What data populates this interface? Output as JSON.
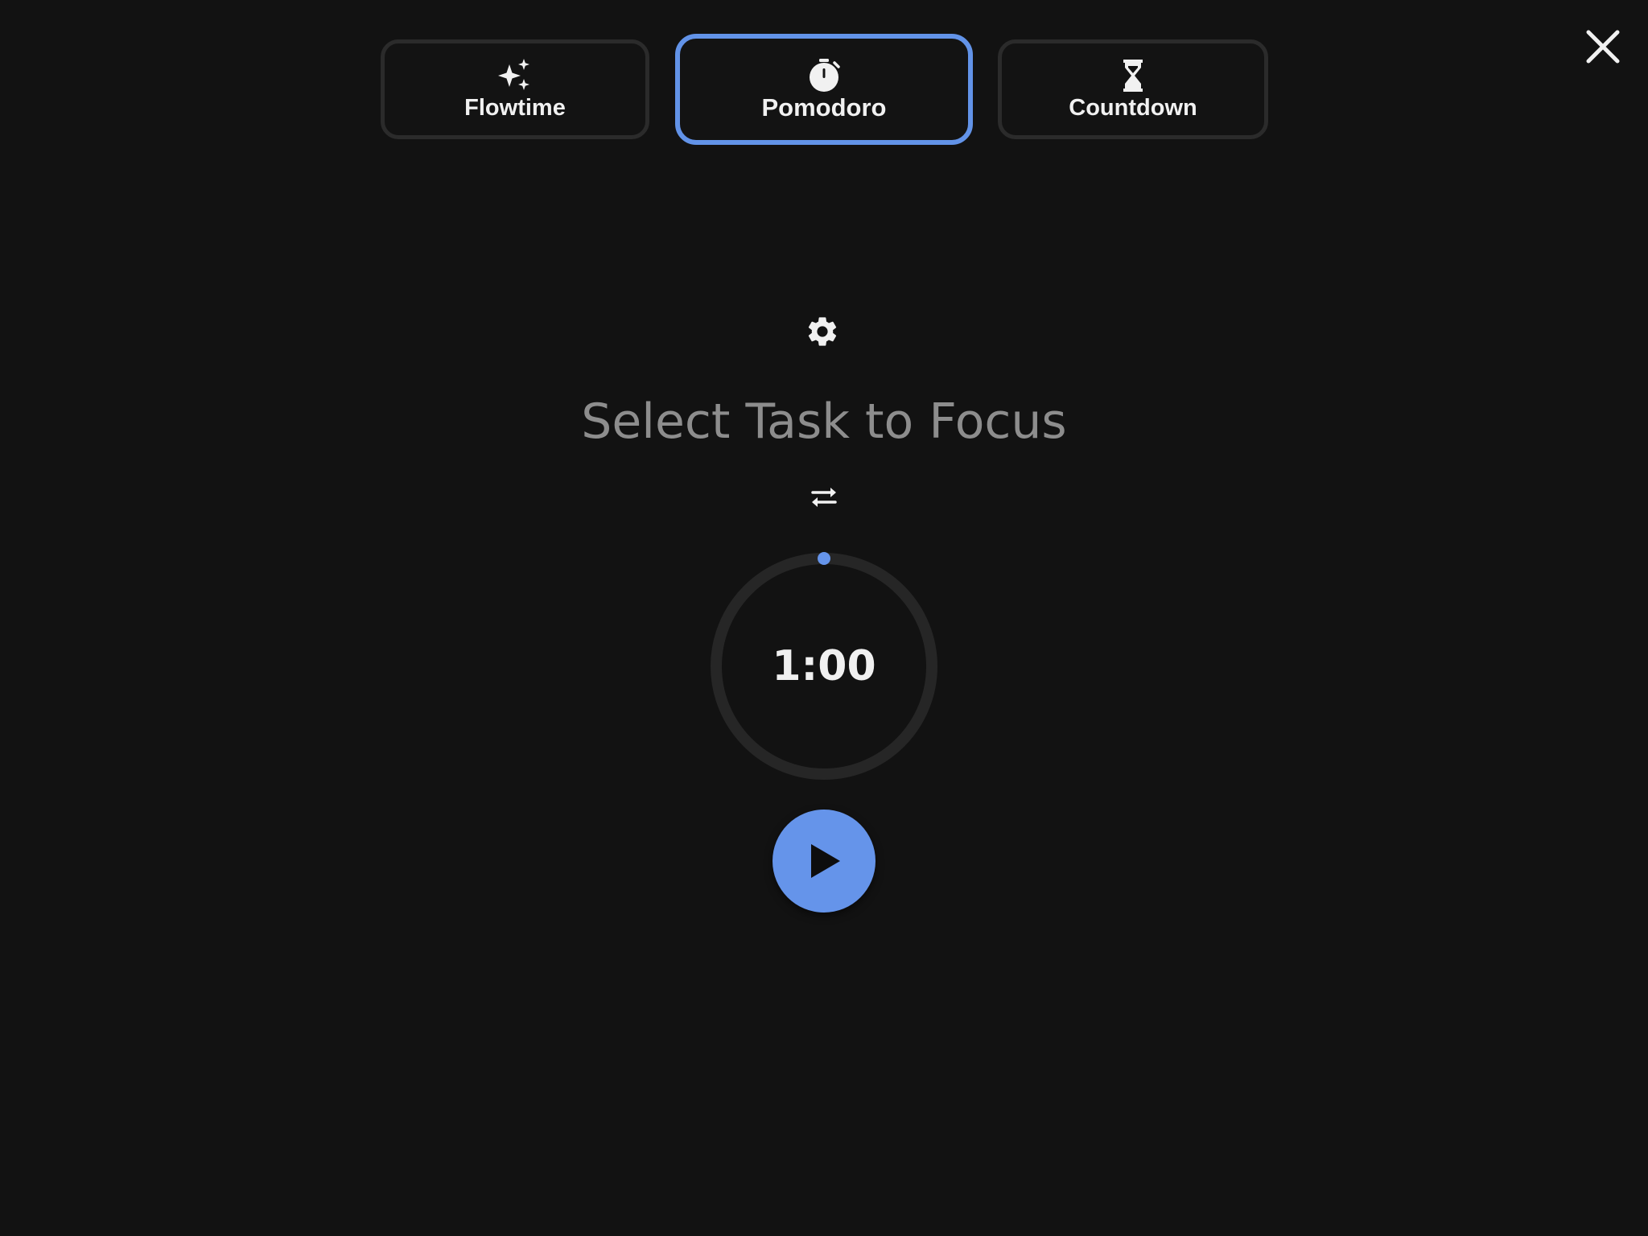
{
  "mode_tabs": [
    {
      "label": "Flowtime",
      "icon": "sparkles-icon",
      "selected": false
    },
    {
      "label": "Pomodoro",
      "icon": "stopwatch-icon",
      "selected": true
    },
    {
      "label": "Countdown",
      "icon": "hourglass-icon",
      "selected": false
    }
  ],
  "header": {
    "close_icon": "close-icon"
  },
  "focus": {
    "settings_icon": "gear-icon",
    "task_prompt": "Select Task to Focus",
    "switch_icon": "swap-arrows-icon"
  },
  "timer": {
    "time_display": "1:00",
    "progress": 0,
    "play_icon": "play-icon"
  },
  "colors": {
    "background": "#121212",
    "accent": "#6594ea",
    "tab_border": "#2b2b2b",
    "ring_track": "#262626",
    "prompt_text": "#8d8d8d",
    "text": "#f1f1f1"
  }
}
